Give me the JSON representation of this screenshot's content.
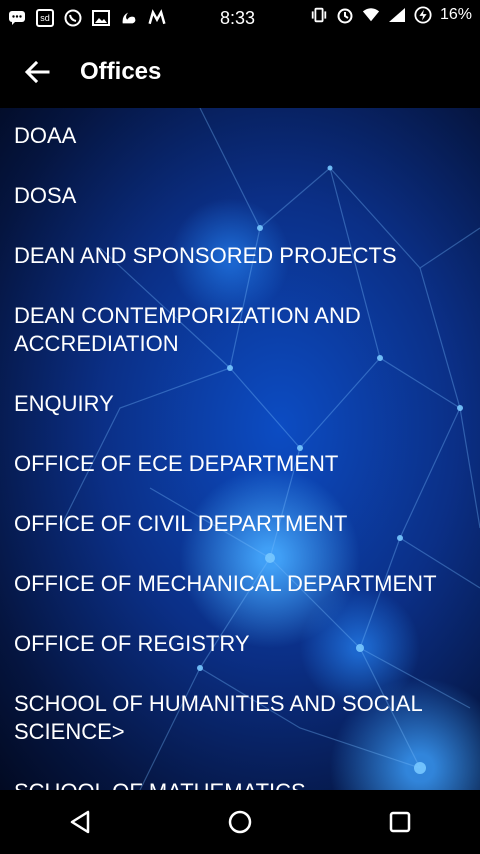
{
  "status_bar": {
    "time": "8:33",
    "battery": "16%",
    "left_icons": [
      "chat-icon",
      "sd-card-icon",
      "whatsapp-icon",
      "image-icon",
      "uc-browser-icon",
      "m-icon"
    ],
    "right_icons": [
      "vibrate-icon",
      "alarm-icon",
      "wifi-icon",
      "signal-icon",
      "battery-icon"
    ]
  },
  "app_bar": {
    "title": "Offices"
  },
  "offices": [
    "DOAA",
    "DOSA",
    "DEAN AND SPONSORED  PROJECTS",
    "DEAN CONTEMPORIZATION AND ACCREDIATION",
    "ENQUIRY",
    "OFFICE OF ECE DEPARTMENT",
    "OFFICE OF CIVIL DEPARTMENT",
    "OFFICE OF MECHANICAL DEPARTMENT",
    "OFFICE OF REGISTRY",
    "SCHOOL OF HUMANITIES AND SOCIAL SCIENCE>",
    "SCHOOL OF MATHEMATICS"
  ],
  "nav": {
    "buttons": [
      "back-icon",
      "home-icon",
      "recents-icon"
    ]
  },
  "colors": {
    "background": "#000000",
    "content_blue": "#0b2f86",
    "text": "#ffffff"
  }
}
